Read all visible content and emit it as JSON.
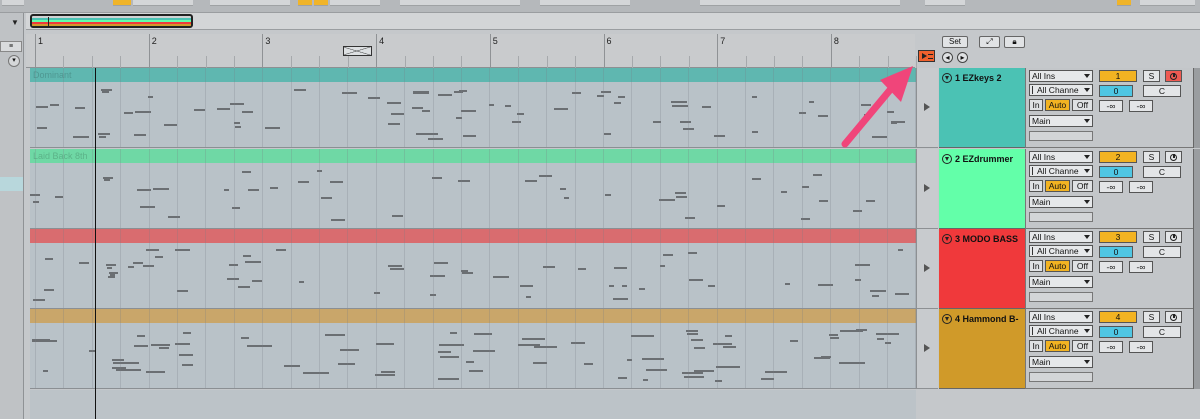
{
  "ruler": {
    "bars": [
      "1",
      "2",
      "3",
      "4",
      "5",
      "6",
      "7",
      "8"
    ]
  },
  "header_controls": {
    "set_label": "Set"
  },
  "clips": [
    "Dominant",
    "Laid Back 8th",
    "",
    ""
  ],
  "tracks": [
    {
      "name": "1 EZkeys 2",
      "color": "#4bc2b4",
      "input": "All Ins",
      "channel": "All Channe",
      "mon_in": "In",
      "mon_auto": "Auto",
      "mon_off": "Off",
      "output": "Main",
      "number": "1",
      "solo": "S",
      "volume": "0",
      "pan": "C",
      "send_a": "-∞",
      "send_b": "-∞"
    },
    {
      "name": "2 EZdrummer",
      "color": "#63ffa9",
      "input": "All Ins",
      "channel": "All Channe",
      "mon_in": "In",
      "mon_auto": "Auto",
      "mon_off": "Off",
      "output": "Main",
      "number": "2",
      "solo": "S",
      "volume": "0",
      "pan": "C",
      "send_a": "-∞",
      "send_b": "-∞"
    },
    {
      "name": "3 MODO BASS",
      "color": "#f0393b",
      "input": "All Ins",
      "channel": "All Channe",
      "mon_in": "In",
      "mon_auto": "Auto",
      "mon_off": "Off",
      "output": "Main",
      "number": "3",
      "solo": "S",
      "volume": "0",
      "pan": "C",
      "send_a": "-∞",
      "send_b": "-∞"
    },
    {
      "name": "4 Hammond B-",
      "color": "#d09a29",
      "input": "All Ins",
      "channel": "All Channe",
      "mon_in": "In",
      "mon_auto": "Auto",
      "mon_off": "Off",
      "output": "Main",
      "number": "4",
      "solo": "S",
      "volume": "0",
      "pan": "C",
      "send_a": "-∞",
      "send_b": "-∞"
    }
  ],
  "colors": {
    "accent_yellow": "#f2b322",
    "accent_cyan": "#4fc6e3",
    "arm_red": "#ee5a52",
    "arrow_pink": "#f0457a"
  }
}
